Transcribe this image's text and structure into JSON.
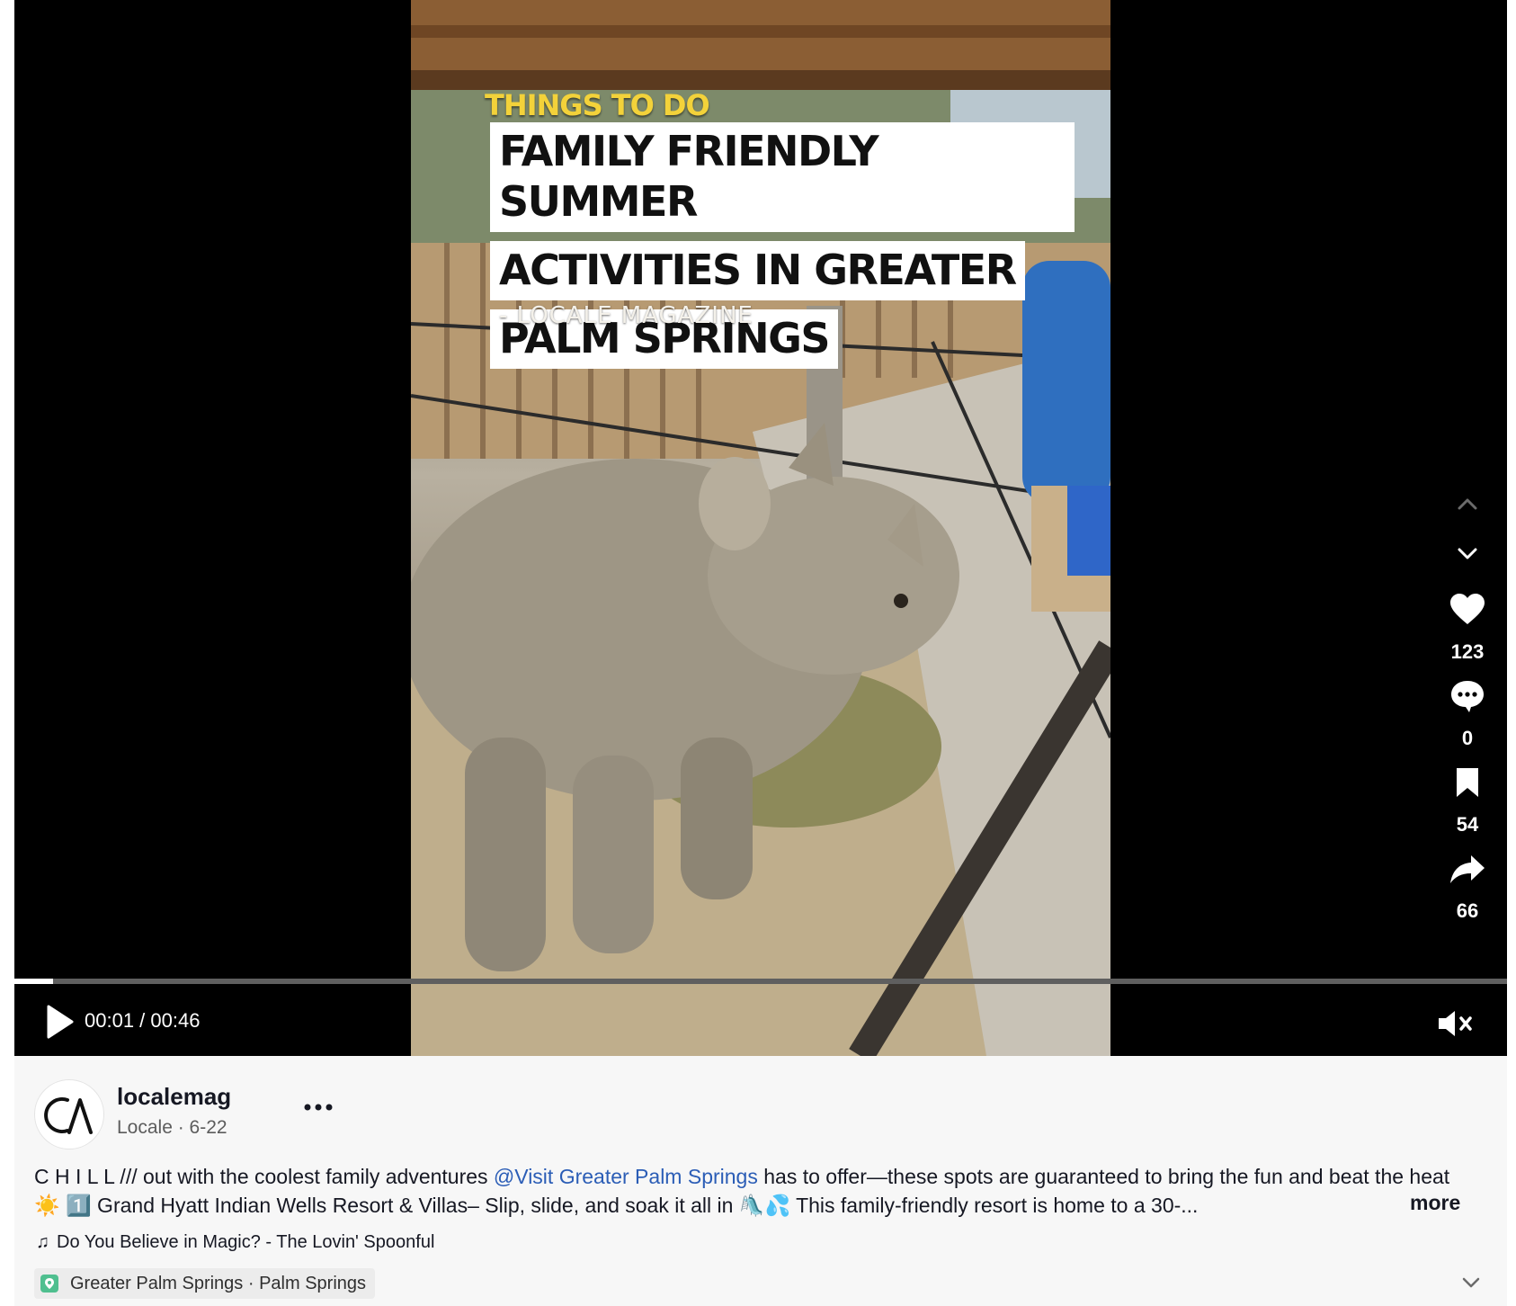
{
  "video": {
    "overlay_tag": "THINGS TO DO",
    "headline_lines": [
      "FAMILY FRIENDLY SUMMER",
      "ACTIVITIES IN GREATER",
      "PALM SPRINGS"
    ],
    "source_text": "- LOCALE MAGAZINE",
    "progress_fraction": 0.026,
    "time_display": "00:01 / 00:46"
  },
  "actions": {
    "likes": "123",
    "comments": "0",
    "bookmarks": "54",
    "shares": "66"
  },
  "post": {
    "author": "localemag",
    "meta": "Locale · 6-22",
    "caption_part1": "C H I L L /// out with the coolest family adventures ",
    "mention": "@Visit Greater Palm Springs",
    "caption_part2": " has to offer—these spots are guaranteed to bring the fun and beat the heat ☀️ 1️⃣ Grand Hyatt Indian Wells Resort & Villas– Slip, slide, and soak it all in 🛝💦 This family-friendly resort is home to a 30-...",
    "more_label": "more",
    "music": "Do You Believe in Magic? - The Lovin' Spoonful",
    "location": "Greater Palm Springs · Palm Springs"
  },
  "icons": {
    "up": "chevron-up-icon",
    "down": "chevron-down-icon",
    "like": "heart-icon",
    "comment": "comment-icon",
    "bookmark": "bookmark-icon",
    "share": "share-icon",
    "play": "play-icon",
    "mute": "mute-icon",
    "music": "music-note-icon",
    "location": "location-pin-icon",
    "expand": "expand-chevron-icon"
  },
  "colors": {
    "mention": "#2b5db6",
    "tag": "#f3d23a",
    "location_pin": "#4fbf8f"
  }
}
